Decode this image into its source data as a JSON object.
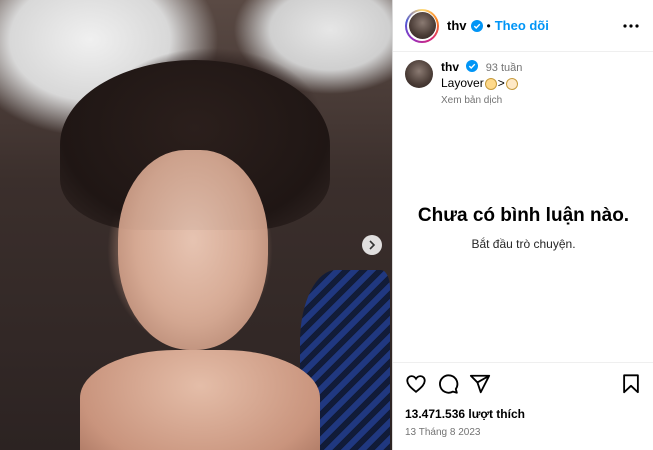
{
  "post": {
    "username": "thv",
    "follow_label": "Theo dõi",
    "separator": "•",
    "caption": {
      "username": "thv",
      "time_ago": "93 tuần",
      "text_prefix": "Layover",
      "text_mid": ">",
      "translate_label": "Xem bản dịch"
    },
    "comments_empty": {
      "title": "Chưa có bình luận nào.",
      "subtitle": "Bắt đầu trò chuyện."
    },
    "likes": "13.471.536 lượt thích",
    "date": "13 Tháng 8 2023"
  },
  "icons": {
    "header": [
      "avatar",
      "verified-icon",
      "more-icon"
    ],
    "photo": [
      "next-arrow-icon"
    ],
    "actions": [
      "heart-icon",
      "comment-icon",
      "share-icon",
      "bookmark-icon"
    ]
  },
  "colors": {
    "accent": "#0095f6",
    "verified": "#0095f6",
    "muted": "#737373"
  }
}
